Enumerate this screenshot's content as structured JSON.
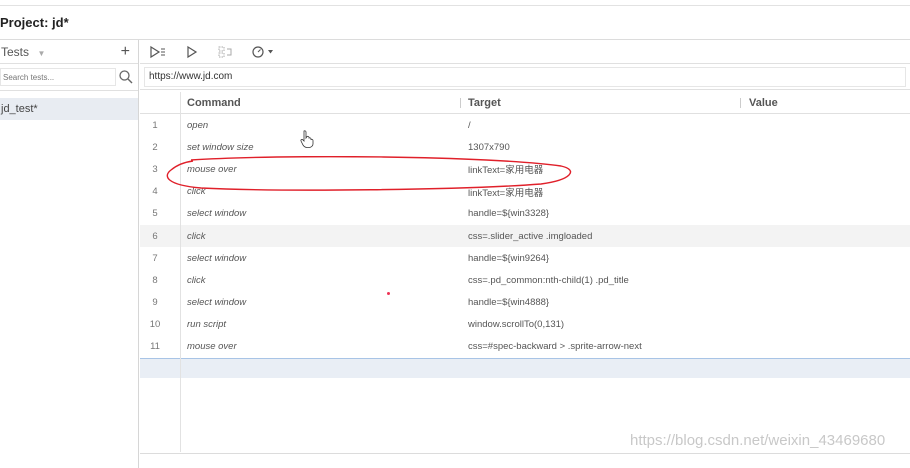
{
  "project": {
    "label": "Project: jd*"
  },
  "sidebar": {
    "tests_title": "Tests",
    "tests_caret": "▼",
    "add_button": "+",
    "search_placeholder": "Search tests...",
    "items": [
      {
        "label": "jd_test*"
      }
    ]
  },
  "toolbar": {
    "icons": [
      "run-all-icon",
      "run-icon",
      "step-icon",
      "speed-icon"
    ]
  },
  "url": {
    "value": "https://www.jd.com"
  },
  "table": {
    "headers": {
      "command": "Command",
      "target": "Target",
      "value": "Value"
    },
    "rows": [
      {
        "num": "1",
        "command": "open",
        "target": "/"
      },
      {
        "num": "2",
        "command": "set window size",
        "target": "1307x790"
      },
      {
        "num": "3",
        "command": "mouse over",
        "target": "linkText=家用电器"
      },
      {
        "num": "4",
        "command": "click",
        "target": "linkText=家用电器"
      },
      {
        "num": "5",
        "command": "select window",
        "target": "handle=${win3328}"
      },
      {
        "num": "6",
        "command": "click",
        "target": "css=.slider_active .imgloaded"
      },
      {
        "num": "7",
        "command": "select window",
        "target": "handle=${win9264}"
      },
      {
        "num": "8",
        "command": "click",
        "target": "css=.pd_common:nth-child(1) .pd_title"
      },
      {
        "num": "9",
        "command": "select window",
        "target": "handle=${win4888}"
      },
      {
        "num": "10",
        "command": "run script",
        "target": "window.scrollTo(0,131)"
      },
      {
        "num": "11",
        "command": "mouse over",
        "target": "css=#spec-backward > .sprite-arrow-next"
      }
    ]
  },
  "watermark": "https://blog.csdn.net/weixin_43469680",
  "colors": {
    "annotation": "#e0202a",
    "selected_row": "#e9eef5",
    "alt_row": "#f3f3f3"
  }
}
